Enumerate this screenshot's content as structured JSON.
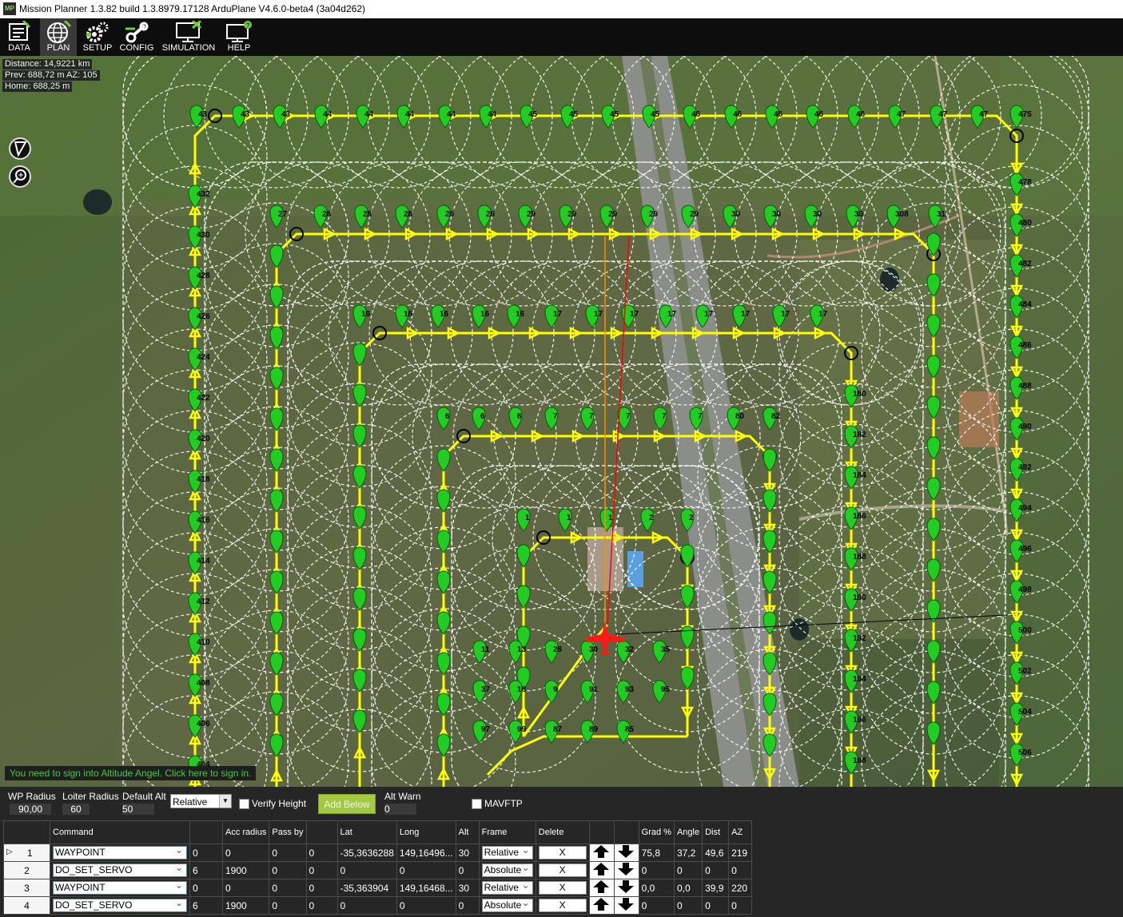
{
  "window": {
    "title": "Mission Planner 1.3.82 build 1.3.8979.17128 ArduPlane V4.6.0-beta4 (3a04d262)",
    "logo_text": "MP"
  },
  "toolbar": {
    "items": [
      {
        "label": "DATA",
        "icon": "data-icon"
      },
      {
        "label": "PLAN",
        "icon": "globe-icon",
        "active": true
      },
      {
        "label": "SETUP",
        "icon": "gears-icon"
      },
      {
        "label": "CONFIG",
        "icon": "wrench-icon"
      },
      {
        "label": "SIMULATION",
        "icon": "monitor-icon"
      },
      {
        "label": "HELP",
        "icon": "help-monitor-icon"
      }
    ]
  },
  "map": {
    "info": {
      "distance": "Distance: 14,9221 km",
      "prev": "Prev: 688,72 m AZ: 105",
      "home": "Home: 688,25 m"
    },
    "sign_in_banner": "You need to sign into Altitude Angel. Click here to sign in.",
    "colors": {
      "path": "#ffff00",
      "waypoint": "#22cc22",
      "radius_circle": "#ffffff",
      "plane": "#ff1a1a",
      "heading_line": "#ff0000",
      "target_line": "#ff8c00"
    },
    "waypoint_labels": {
      "top_row": [
        "43",
        "43",
        "43",
        "44",
        "44",
        "44",
        "44",
        "44",
        "45",
        "45",
        "45",
        "45",
        "46",
        "46",
        "46",
        "46",
        "46",
        "47",
        "47",
        "47"
      ],
      "right_col": [
        "478",
        "480",
        "482",
        "484",
        "486",
        "488",
        "490",
        "492",
        "494",
        "496",
        "498",
        "500",
        "502",
        "504",
        "506"
      ],
      "left_col": [
        "432",
        "430",
        "428",
        "426",
        "424",
        "422",
        "420",
        "418",
        "416",
        "414",
        "412",
        "410",
        "408",
        "406",
        "404"
      ],
      "ring2_top": [
        "27",
        "28",
        "28",
        "28",
        "28",
        "28",
        "29",
        "29",
        "29",
        "29",
        "29",
        "30",
        "30",
        "30",
        "30",
        "308",
        "31"
      ],
      "ring3_top": [
        "16",
        "16",
        "16",
        "16",
        "16",
        "17",
        "17",
        "17",
        "17",
        "17",
        "17",
        "17",
        "17"
      ],
      "ring3_right": [
        "180",
        "182",
        "184",
        "186",
        "188",
        "190",
        "192",
        "194",
        "196",
        "198",
        "200"
      ],
      "ring4_top": [
        "6",
        "6",
        "6",
        "7",
        "7",
        "7",
        "7",
        "7",
        "80",
        "82"
      ],
      "ring5_top": [
        "1",
        "1",
        "1",
        "2",
        "2"
      ],
      "inner_misc": [
        "11",
        "13",
        "28",
        "30",
        "32",
        "35",
        "37",
        "18",
        "9",
        "91",
        "93",
        "95",
        "97",
        "99",
        "87",
        "89",
        "85"
      ]
    }
  },
  "controls": {
    "wp_radius_label": "WP Radius",
    "wp_radius_value": "90,00",
    "loiter_radius_label": "Loiter Radius",
    "loiter_radius_value": "60",
    "default_alt_label": "Default Alt",
    "default_alt_value": "50",
    "frame_value": "Relative",
    "verify_height_label": "Verify Height",
    "add_below_label": "Add Below",
    "alt_warn_label": "Alt Warn",
    "alt_warn_value": "0",
    "mavftp_label": "MAVFTP"
  },
  "table": {
    "headers": [
      "",
      "Command",
      "",
      "Acc radius",
      "Pass by",
      "",
      "Lat",
      "Long",
      "Alt",
      "Frame",
      "Delete",
      "",
      "",
      "Grad %",
      "Angle",
      "Dist",
      "AZ"
    ],
    "rows": [
      {
        "index": "1",
        "command": "WAYPOINT",
        "p1": "0",
        "acc": "0",
        "pass": "0",
        "p4": "0",
        "lat": "-35,3636288",
        "long": "149,16496...",
        "alt": "30",
        "frame": "Relative",
        "delete": "X",
        "grad": "75,8",
        "angle": "37,2",
        "dist": "49,6",
        "az": "219"
      },
      {
        "index": "2",
        "command": "DO_SET_SERVO",
        "p1": "6",
        "acc": "1900",
        "pass": "0",
        "p4": "0",
        "lat": "0",
        "long": "0",
        "alt": "0",
        "frame": "Absolute",
        "delete": "X",
        "grad": "0",
        "angle": "0",
        "dist": "0",
        "az": "0"
      },
      {
        "index": "3",
        "command": "WAYPOINT",
        "p1": "0",
        "acc": "0",
        "pass": "0",
        "p4": "0",
        "lat": "-35,363904",
        "long": "149,16468...",
        "alt": "30",
        "frame": "Relative",
        "delete": "X",
        "grad": "0,0",
        "angle": "0,0",
        "dist": "39,9",
        "az": "220"
      },
      {
        "index": "4",
        "command": "DO_SET_SERVO",
        "p1": "6",
        "acc": "1900",
        "pass": "0",
        "p4": "0",
        "lat": "0",
        "long": "0",
        "alt": "0",
        "frame": "Absolute",
        "delete": "X",
        "grad": "0",
        "angle": "0",
        "dist": "0",
        "az": "0"
      }
    ]
  }
}
